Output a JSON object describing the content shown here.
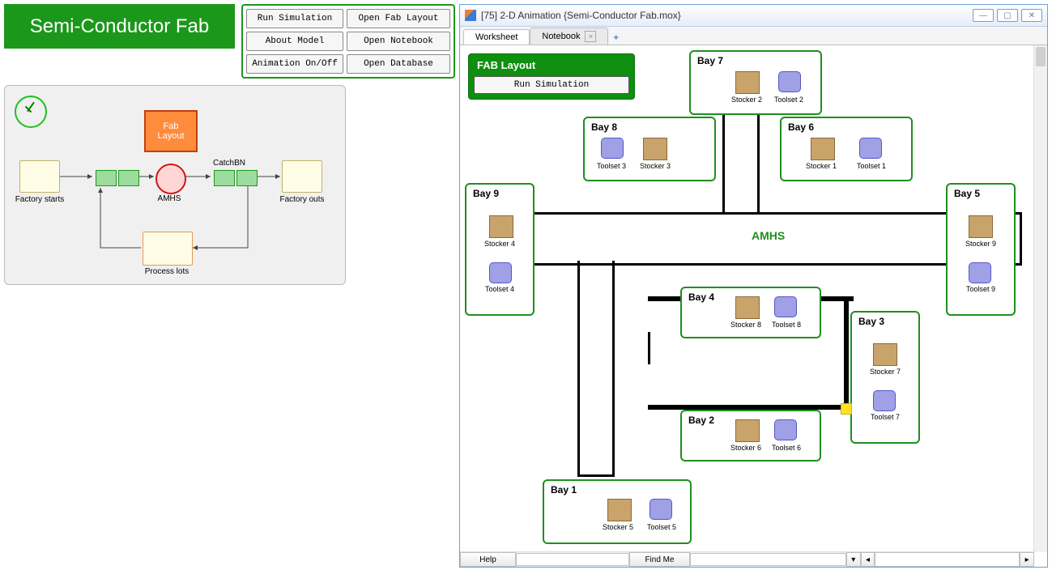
{
  "banner": {
    "title": "Semi-Conductor Fab"
  },
  "buttons": {
    "run": "Run Simulation",
    "open_layout": "Open Fab Layout",
    "about": "About Model",
    "open_nb": "Open Notebook",
    "anim": "Animation On/Off",
    "open_db": "Open Database"
  },
  "model": {
    "fab_layout": "Fab\nLayout",
    "factory_starts": "Factory starts",
    "factory_outs": "Factory outs",
    "amhs": "AMHS",
    "catchbn": "CatchBN",
    "process_lots": "Process lots"
  },
  "anim_window": {
    "title": "[75] 2-D Animation {Semi-Conductor Fab.mox}",
    "tabs": {
      "worksheet": "Worksheet",
      "notebook": "Notebook"
    },
    "fab_panel": {
      "title": "FAB Layout",
      "run": "Run Simulation"
    },
    "amhs": "AMHS",
    "bays": {
      "b1": "Bay 1",
      "b2": "Bay 2",
      "b3": "Bay 3",
      "b4": "Bay 4",
      "b5": "Bay 5",
      "b6": "Bay 6",
      "b7": "Bay 7",
      "b8": "Bay 8",
      "b9": "Bay 9"
    },
    "labels": {
      "s1": "Stocker 1",
      "s2": "Stocker 2",
      "s3": "Stocker 3",
      "s4": "Stocker 4",
      "s5": "Stocker 5",
      "s6": "Stocker 6",
      "s7": "Stocker 7",
      "s8": "Stocker 8",
      "s9": "Stocker 9",
      "t1": "Toolset 1",
      "t2": "Toolset 2",
      "t3": "Toolset 3",
      "t4": "Toolset 4",
      "t5": "Toolset 5",
      "t6": "Toolset 6",
      "t7": "Toolset 7",
      "t8": "Toolset 8",
      "t9": "Toolset 9"
    },
    "footer": {
      "help": "Help",
      "find": "Find Me"
    }
  }
}
